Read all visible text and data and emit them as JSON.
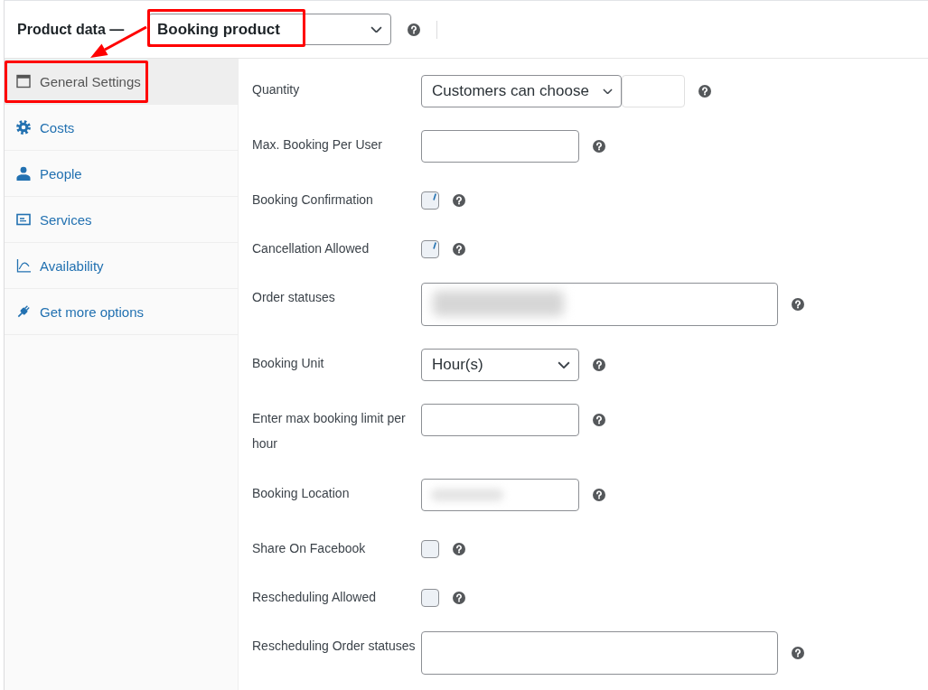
{
  "header": {
    "title": "Product data —",
    "product_type": {
      "value": "Booking product",
      "highlighted": true
    }
  },
  "callout_arrow": true,
  "tabs": [
    {
      "label": "General Settings",
      "selected": true,
      "highlighted": true
    },
    {
      "label": "Costs",
      "selected": false,
      "highlighted": false
    },
    {
      "label": "People",
      "selected": false,
      "highlighted": false
    },
    {
      "label": "Services",
      "selected": false,
      "highlighted": false
    },
    {
      "label": "Availability",
      "selected": false,
      "highlighted": false
    },
    {
      "label": "Get more options",
      "selected": false,
      "highlighted": false
    }
  ],
  "fields": [
    {
      "kind": "select_with_input",
      "label": "Quantity",
      "value": "Customers can choose"
    },
    {
      "kind": "input",
      "label": "Max. Booking Per User",
      "blurred": false
    },
    {
      "kind": "checkbox",
      "label": "Booking Confirmation",
      "checked": true
    },
    {
      "kind": "checkbox",
      "label": "Cancellation Allowed",
      "checked": true
    },
    {
      "kind": "multiselect",
      "label": "Order statuses",
      "blurred": true
    },
    {
      "kind": "select",
      "label": "Booking Unit",
      "value": "Hour(s)"
    },
    {
      "kind": "input",
      "label": "Enter max booking limit per hour",
      "blurred": false
    },
    {
      "kind": "input",
      "label": "Booking Location",
      "blurred": true
    },
    {
      "kind": "checkbox",
      "label": "Share On Facebook",
      "checked": false
    },
    {
      "kind": "checkbox",
      "label": "Rescheduling Allowed",
      "checked": false
    },
    {
      "kind": "multiselect",
      "label": "Rescheduling Order statuses",
      "blurred": false
    }
  ]
}
